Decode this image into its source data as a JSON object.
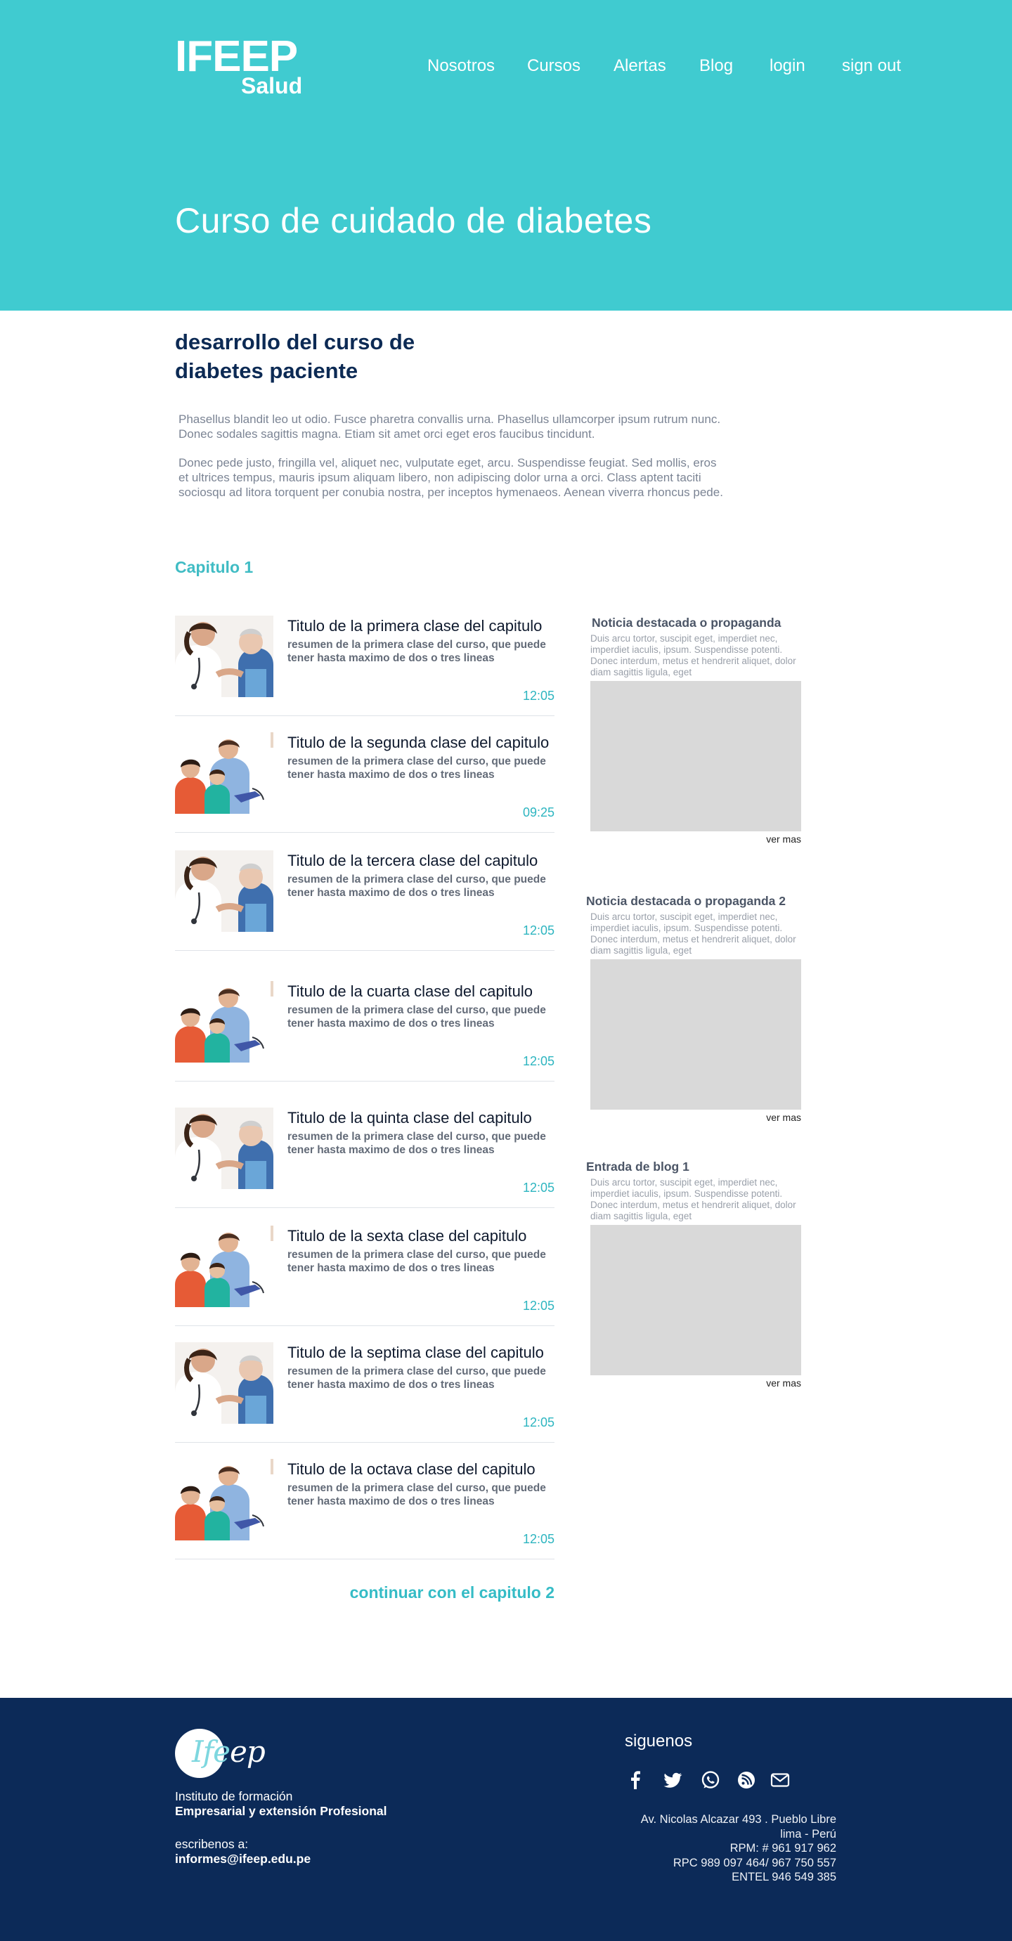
{
  "header": {
    "logo_line1": "IFEEP",
    "logo_line2": "Salud",
    "nav": [
      "Nosotros",
      "Cursos",
      "Alertas",
      "Blog",
      "login",
      "sign out"
    ],
    "page_title": "Curso de  cuidado de diabetes",
    "bg_color": "#40cbd0"
  },
  "course": {
    "heading_line1": "desarrollo del curso de",
    "heading_line2": "diabetes paciente",
    "paragraph1": "Phasellus blandit leo ut odio. Fusce pharetra convallis urna. Phasellus ullamcorper ipsum rutrum nunc. Donec sodales sagittis magna. Etiam sit amet orci eget eros faucibus tincidunt.",
    "paragraph2": "Donec pede justo, fringilla vel, aliquet nec, vulputate eget, arcu. Suspendisse feugiat. Sed mollis, eros et ultrices tempus, mauris ipsum aliquam libero, non adipiscing dolor urna a orci. Class aptent taciti sociosqu ad litora torquent per conubia nostra, per inceptos hymenaeos. Aenean viverra rhoncus pede.",
    "chapter": "Capitulo 1",
    "continue_label": "continuar con el capitulo 2"
  },
  "classes": [
    {
      "title": "Titulo de la primera clase del capitulo",
      "desc": "resumen de la primera clase del curso, que puede tener hasta maximo de dos o tres lineas",
      "time": "12:05",
      "thumb": "nurse-elderly"
    },
    {
      "title": "Titulo de la segunda clase del capitulo",
      "desc": "resumen de la primera clase del curso, que puede tener hasta maximo de dos o tres lineas",
      "time": "09:25",
      "thumb": "doctor-family"
    },
    {
      "title": "Titulo de la tercera clase del capitulo",
      "desc": "resumen de la primera clase del curso, que puede tener hasta maximo de dos o tres lineas",
      "time": "12:05",
      "thumb": "nurse-elderly"
    },
    {
      "title": "Titulo de la cuarta clase del capitulo",
      "desc": "resumen de la primera clase del curso, que puede tener hasta maximo de dos o tres lineas",
      "time": "12:05",
      "thumb": "doctor-family"
    },
    {
      "title": "Titulo de la quinta clase del capitulo",
      "desc": "resumen de la primera clase del curso, que puede tener hasta maximo de dos o tres lineas",
      "time": "12:05",
      "thumb": "nurse-elderly"
    },
    {
      "title": "Titulo de la sexta clase del capitulo",
      "desc": "resumen de la primera clase del curso, que puede tener hasta maximo de dos o tres lineas",
      "time": "12:05",
      "thumb": "doctor-family"
    },
    {
      "title": "Titulo de la septima clase del capitulo",
      "desc": "resumen de la primera clase del curso, que puede tener hasta maximo de dos o tres lineas",
      "time": "12:05",
      "thumb": "nurse-elderly"
    },
    {
      "title": "Titulo de la octava clase del capitulo",
      "desc": "resumen de la primera clase del curso, que puede tener hasta maximo de dos o tres lineas",
      "time": "12:05",
      "thumb": "doctor-family"
    }
  ],
  "sidebar": [
    {
      "title": "Noticia destacada o propaganda",
      "desc": "Duis arcu tortor, suscipit eget, imperdiet nec, imperdiet iaculis, ipsum. Suspendisse potenti. Donec interdum, metus et hendrerit aliquet, dolor diam sagittis ligula, eget",
      "more": "ver mas"
    },
    {
      "title": "Noticia destacada o propaganda 2",
      "desc": "Duis arcu tortor, suscipit eget, imperdiet nec, imperdiet iaculis, ipsum. Suspendisse potenti. Donec interdum, metus et hendrerit aliquet, dolor diam sagittis ligula, eget",
      "more": "ver mas"
    },
    {
      "title": "Entrada de blog  1",
      "desc": "Duis arcu tortor, suscipit eget, imperdiet nec, imperdiet iaculis, ipsum. Suspendisse potenti. Donec interdum, metus et hendrerit aliquet, dolor diam sagittis ligula, eget",
      "more": "ver mas"
    }
  ],
  "footer": {
    "logo_text": "Ifeep",
    "institute_line1": "Instituto de formación",
    "institute_line2": "Empresarial y extensión Profesional",
    "write_label": "escribenos a:",
    "email": "informes@ifeep.edu.pe",
    "follow_label": "siguenos",
    "social_icons": [
      "facebook-icon",
      "twitter-icon",
      "whatsapp-icon",
      "rss-icon",
      "mail-icon"
    ],
    "address": [
      "Av. Nicolas Alcazar 493 . Pueblo Libre",
      "lima - Perú",
      "RPM: # 961 917 962",
      "RPC 989 097 464/ 967 750 557",
      "ENTEL 946 549 385"
    ],
    "bg_color": "#0c2a58"
  }
}
